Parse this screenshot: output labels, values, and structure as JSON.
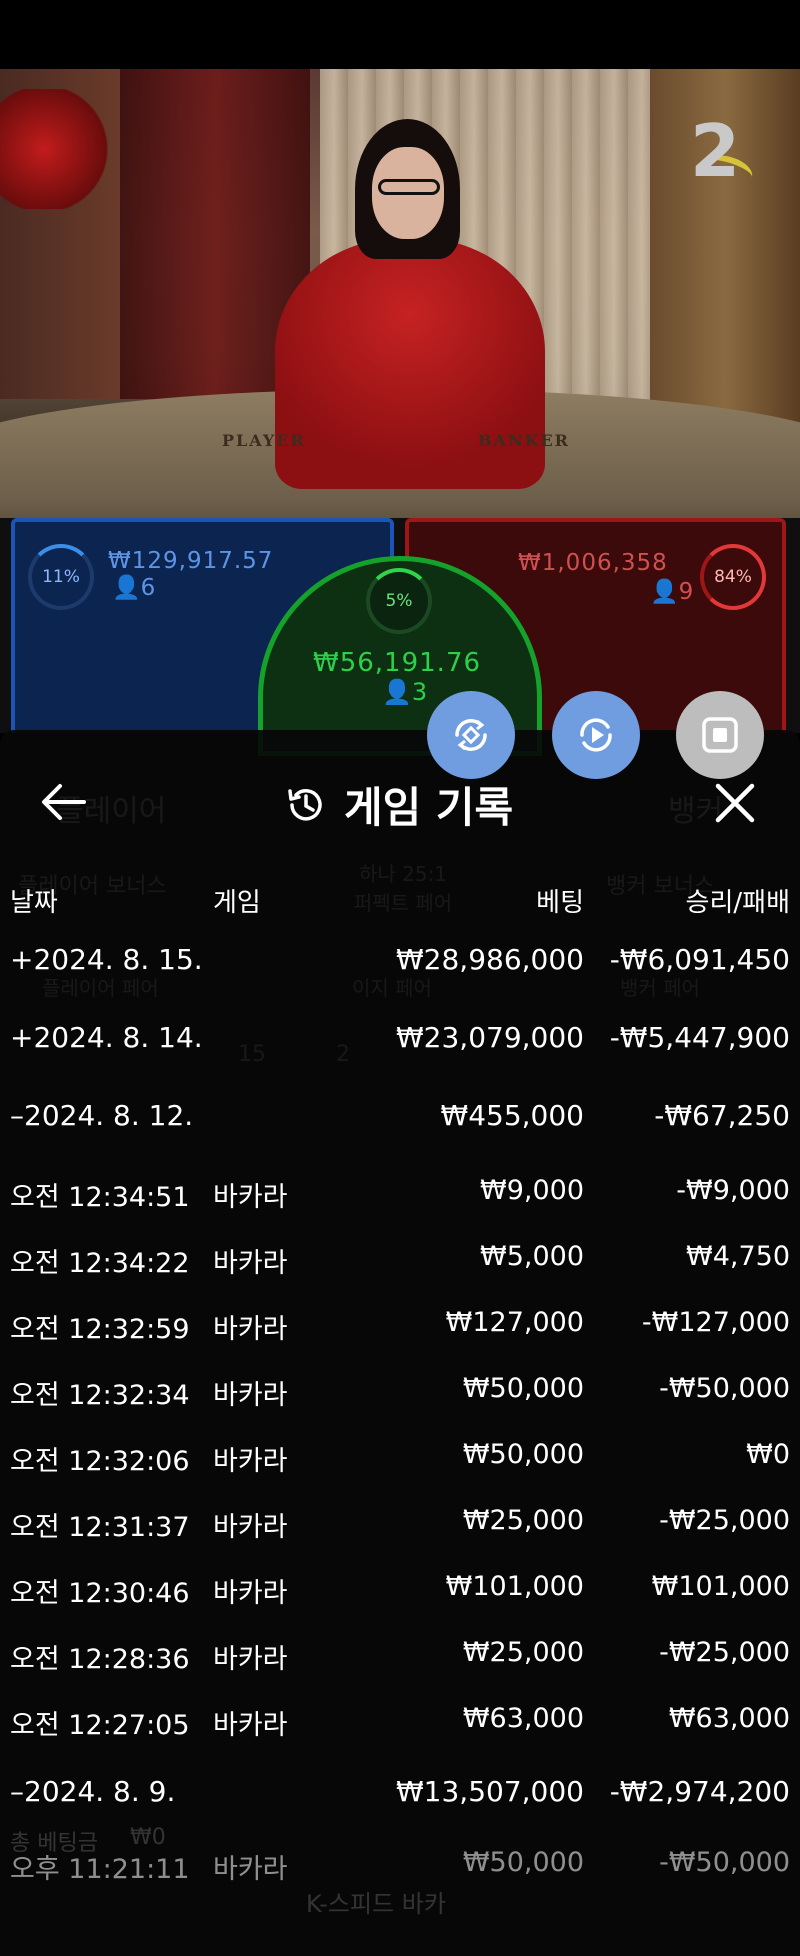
{
  "video": {
    "round_counter": "2",
    "table_text_player": "PLAYER",
    "table_text_banker": "BANKER"
  },
  "betting": {
    "player": {
      "percent": "11%",
      "amount": "₩129,917.57",
      "count": "6"
    },
    "tie": {
      "percent": "5%",
      "amount": "₩56,191.76",
      "count": "3"
    },
    "banker": {
      "percent": "84%",
      "amount": "₩1,006,358",
      "count": "9"
    }
  },
  "fabs": [
    "rebet-icon",
    "replay-icon",
    "stop-icon"
  ],
  "panel": {
    "title": "게임 기록",
    "columns": {
      "date": "날짜",
      "game": "게임",
      "bet": "베팅",
      "winloss": "승리/패배"
    },
    "background_labels": [
      "플레이어",
      "뱅커",
      "플레이어 보너스",
      "하나 25:1 퍼펙트 페어",
      "뱅커 보너스",
      "플레이어 페어",
      "이지 페어",
      "뱅커 페어",
      "15",
      "2",
      "총 베팅금",
      "₩0",
      "K-스피드 바카"
    ],
    "rows": [
      {
        "type": "group",
        "date": "+2024. 8. 15.",
        "game": "",
        "bet": "₩28,986,000",
        "wl": "-₩6,091,450"
      },
      {
        "type": "group",
        "date": "+2024. 8. 14.",
        "game": "",
        "bet": "₩23,079,000",
        "wl": "-₩5,447,900"
      },
      {
        "type": "group",
        "date": "–2024. 8. 12.",
        "game": "",
        "bet": "₩455,000",
        "wl": "-₩67,250"
      },
      {
        "type": "item",
        "date": "오전 12:34:51",
        "game": "바카라",
        "bet": "₩9,000",
        "wl": "-₩9,000"
      },
      {
        "type": "item",
        "date": "오전 12:34:22",
        "game": "바카라",
        "bet": "₩5,000",
        "wl": "₩4,750"
      },
      {
        "type": "item",
        "date": "오전 12:32:59",
        "game": "바카라",
        "bet": "₩127,000",
        "wl": "-₩127,000"
      },
      {
        "type": "item",
        "date": "오전 12:32:34",
        "game": "바카라",
        "bet": "₩50,000",
        "wl": "-₩50,000"
      },
      {
        "type": "item",
        "date": "오전 12:32:06",
        "game": "바카라",
        "bet": "₩50,000",
        "wl": "₩0"
      },
      {
        "type": "item",
        "date": "오전 12:31:37",
        "game": "바카라",
        "bet": "₩25,000",
        "wl": "-₩25,000"
      },
      {
        "type": "item",
        "date": "오전 12:30:46",
        "game": "바카라",
        "bet": "₩101,000",
        "wl": "₩101,000"
      },
      {
        "type": "item",
        "date": "오전 12:28:36",
        "game": "바카라",
        "bet": "₩25,000",
        "wl": "-₩25,000"
      },
      {
        "type": "item",
        "date": "오전 12:27:05",
        "game": "바카라",
        "bet": "₩63,000",
        "wl": "₩63,000"
      },
      {
        "type": "group",
        "date": "–2024. 8. 9.",
        "game": "",
        "bet": "₩13,507,000",
        "wl": "-₩2,974,200"
      },
      {
        "type": "item",
        "date": "오후 11:21:11",
        "game": "바카라",
        "bet": "₩50,000",
        "wl": "-₩50,000"
      }
    ]
  },
  "colors": {
    "player": "#1c55b8",
    "banker": "#a01616",
    "tie": "#14a22a",
    "fab_blue": "#6f9de0",
    "fab_grey": "#bdbdbd"
  }
}
